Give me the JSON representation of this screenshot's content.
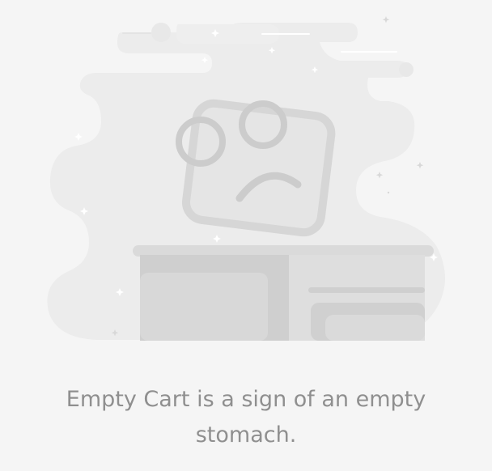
{
  "empty_cart": {
    "message": "Empty Cart is a sign of an empty stomach.",
    "illustration_icon": "sad-face-box-icon"
  },
  "colors": {
    "background": "#f5f5f5",
    "cloud": "#ececec",
    "cloud_light": "#efefef",
    "face_box": "#dddddd",
    "face_stroke": "#c9c9c9",
    "table_top": "#d6d6d6",
    "table_left": "#cfcfcf",
    "table_right": "#dcdcdc",
    "text": "#8f8f8f"
  }
}
